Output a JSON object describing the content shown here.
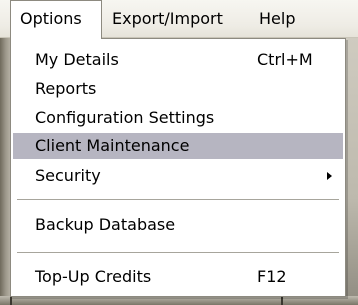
{
  "menubar": {
    "items": [
      {
        "label": "Options",
        "open": true
      },
      {
        "label": "Export/Import"
      },
      {
        "label": "Help"
      }
    ]
  },
  "dropdown": {
    "items": [
      {
        "label": "My Details",
        "shortcut": "Ctrl+M"
      },
      {
        "label": "Reports"
      },
      {
        "label": "Configuration Settings"
      },
      {
        "label": "Client Maintenance",
        "highlighted": true
      },
      {
        "label": "Security",
        "submenu": true,
        "icon": "submenu-arrow-icon"
      },
      {
        "label": "Backup Database"
      },
      {
        "label": "Top-Up Credits",
        "shortcut": "F12"
      }
    ]
  },
  "colors": {
    "highlight": "#b6b5c1",
    "menubar_bg": "#eeece5",
    "border": "#8d8a80"
  }
}
